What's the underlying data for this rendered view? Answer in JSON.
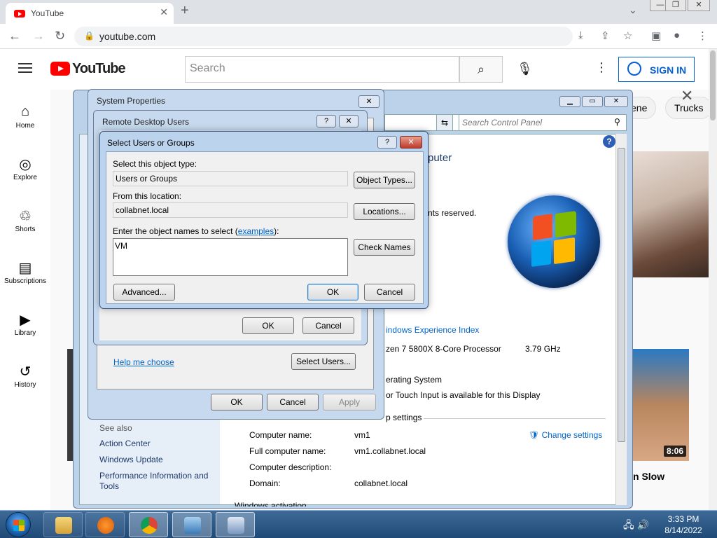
{
  "browser": {
    "tab_title": "YouTube",
    "tab_close": "✕",
    "new_tab": "+",
    "url": "youtube.com",
    "tab_dropdown": "⌄",
    "win_min": "—",
    "win_restore": "❐",
    "win_close": "✕"
  },
  "youtube": {
    "logo_text": "YouTube",
    "search_placeholder": "Search",
    "sign_in": "SIGN IN",
    "sidebar": [
      {
        "label": "Home",
        "icon": "⌂"
      },
      {
        "label": "Explore",
        "icon": "◎"
      },
      {
        "label": "Shorts",
        "icon": "♲"
      },
      {
        "label": "Subscriptions",
        "icon": "▤"
      },
      {
        "label": "Library",
        "icon": "▶"
      },
      {
        "label": "History",
        "icon": "↺"
      }
    ],
    "chips": [
      "ene",
      "Trucks"
    ],
    "video_duration": "8:06",
    "video_title_fragment": "n Slow"
  },
  "control_panel": {
    "search_placeholder": "Search Control Panel",
    "heading_fragment": "puter",
    "copyright_fragment": "nts reserved.",
    "wei_link": "indows Experience Index",
    "processor": "zen 7 5800X 8-Core Processor",
    "processor_speed": "3.79 GHz",
    "os_fragment": "erating System",
    "pen_fragment": "or Touch Input is available for this Display",
    "settings_section": "p settings",
    "see_also": "See also",
    "see_also_links": [
      "Action Center",
      "Windows Update",
      "Performance Information and",
      "Tools"
    ],
    "computer_name_label": "Computer name:",
    "computer_name": "vm1",
    "full_name_label": "Full computer name:",
    "full_name": "vm1.collabnet.local",
    "description_label": "Computer description:",
    "domain_label": "Domain:",
    "domain": "collabnet.local",
    "change_settings": "Change settings",
    "footer_fragment": "Windows activation"
  },
  "system_properties": {
    "title": "System Properties",
    "help_link": "Help me choose",
    "select_users": "Select Users...",
    "ok": "OK",
    "cancel": "Cancel",
    "apply": "Apply"
  },
  "remote_desktop_users": {
    "title": "Remote Desktop Users",
    "ok": "OK",
    "cancel": "Cancel"
  },
  "select_users_dialog": {
    "title": "Select Users or Groups",
    "object_type_label": "Select this object type:",
    "object_type_value": "Users or Groups",
    "object_types_btn": "Object Types...",
    "location_label": "From this location:",
    "location_value": "collabnet.local",
    "locations_btn": "Locations...",
    "names_label_prefix": "Enter the object names to select (",
    "names_label_link": "examples",
    "names_label_suffix": "):",
    "names_value": "VM",
    "check_names_btn": "Check Names",
    "advanced_btn": "Advanced...",
    "ok": "OK",
    "cancel": "Cancel",
    "help": "?",
    "close": "✕"
  },
  "taskbar": {
    "time": "3:33 PM",
    "date": "8/14/2022"
  }
}
